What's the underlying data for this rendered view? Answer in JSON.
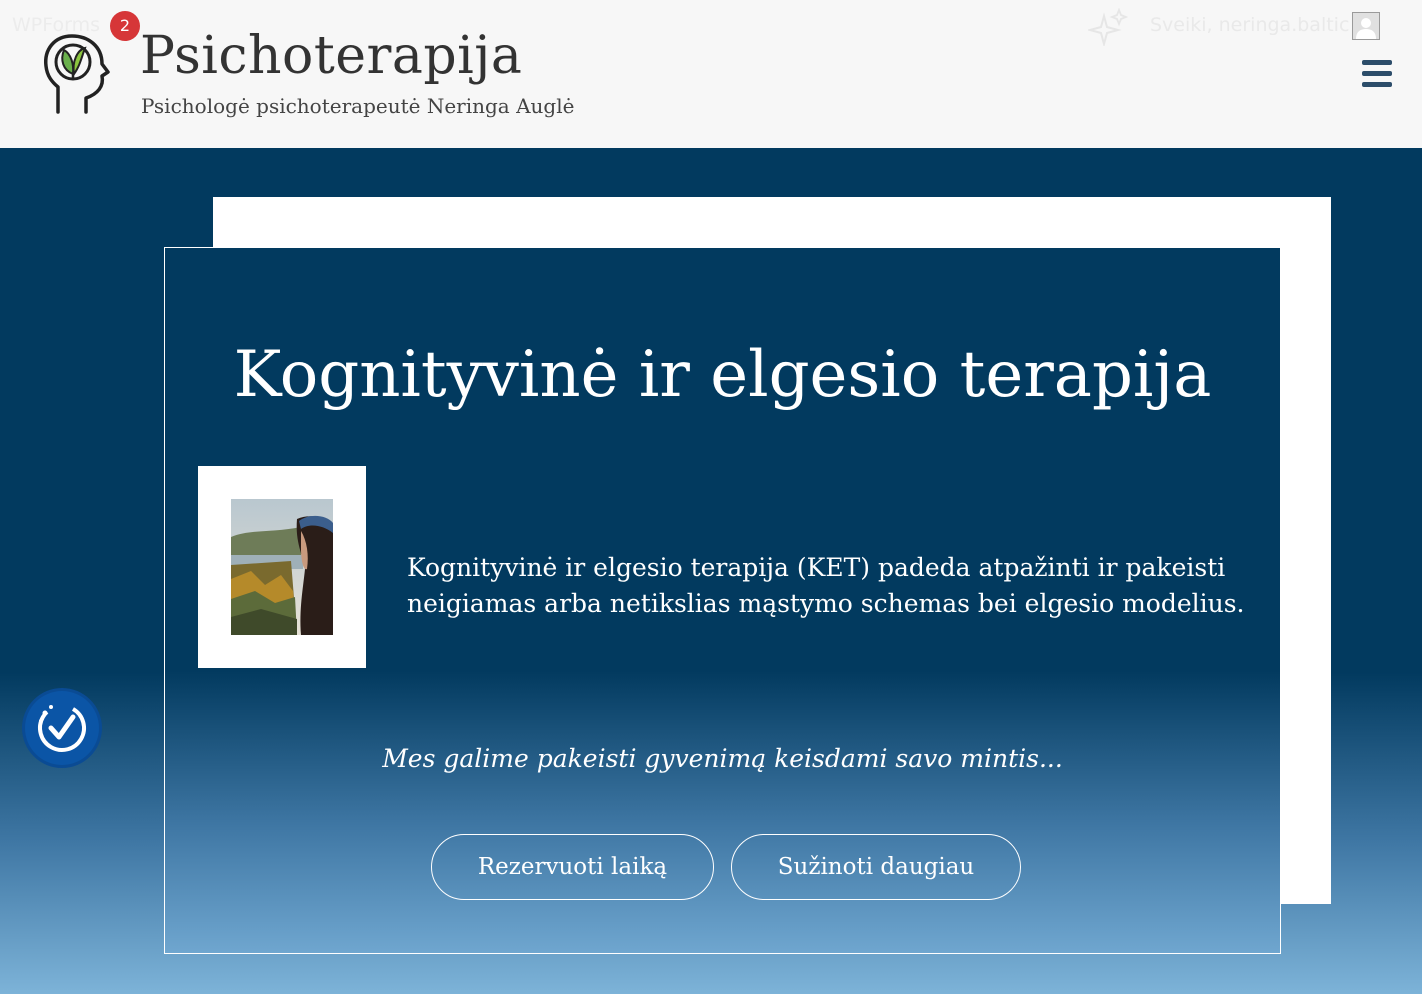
{
  "adminbar": {
    "left_label": "WPForms",
    "notification_count": "2",
    "greeting": "Sveiki, neringa.baltic"
  },
  "site": {
    "title": "Psichoterapija",
    "tagline": "Psichologė psichoterapeutė Neringa Auglė"
  },
  "hero": {
    "title": "Kognityvinė ir elgesio terapija",
    "description": "Kognityvinė ir elgesio terapija (KET) padeda atpažinti ir pakeisti neigiamas arba netikslias mąstymo schemas bei elgesio modelius.",
    "quote": "Mes galime pakeisti gyvenimą keisdami savo mintis...",
    "buttons": {
      "reserve": "Rezervuoti laiką",
      "more": "Sužinoti daugiau"
    }
  },
  "icons": {
    "logo": "head-with-leaf-icon",
    "sparkle": "sparkle-icon",
    "menu": "hamburger-menu-icon",
    "accessibility": "accessibility-check-icon"
  },
  "colors": {
    "hero_navy": "#023a5f",
    "hero_light_blue": "#7db3d8",
    "badge_red": "#d63638",
    "accessibility_blue": "#0b55a6",
    "menu_icon": "#2c4d6a",
    "leaf_green": "#6ab04c"
  }
}
